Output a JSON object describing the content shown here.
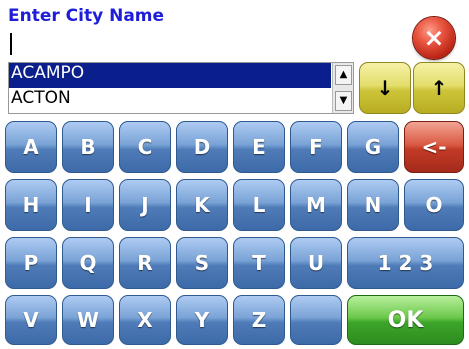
{
  "header": {
    "title": "Enter City Name"
  },
  "input": {
    "value": ""
  },
  "close": {
    "icon": "close-icon",
    "glyph": "×"
  },
  "list": {
    "items": [
      {
        "label": "ACAMPO",
        "selected": true
      },
      {
        "label": "ACTON",
        "selected": false
      }
    ],
    "scroll_up_glyph": "▲",
    "scroll_down_glyph": "▼"
  },
  "nav": {
    "down_glyph": "↓",
    "up_glyph": "↑"
  },
  "keyboard": {
    "row1": [
      "A",
      "B",
      "C",
      "D",
      "E",
      "F",
      "G"
    ],
    "backspace_label": "<-",
    "row2": [
      "H",
      "I",
      "J",
      "K",
      "L",
      "M",
      "N",
      "O"
    ],
    "row3": [
      "P",
      "Q",
      "R",
      "S",
      "T",
      "U"
    ],
    "numbers_label": "1 2 3",
    "row4": [
      "V",
      "W",
      "X",
      "Y",
      "Z",
      ""
    ],
    "ok_label": "OK"
  },
  "colors": {
    "title": "#1e1ed8",
    "key_blue": "#4f7cb8",
    "key_yellow": "#cdc43b",
    "key_red": "#c23a26",
    "key_green": "#3ca52a",
    "selection": "#0a1e8c"
  }
}
